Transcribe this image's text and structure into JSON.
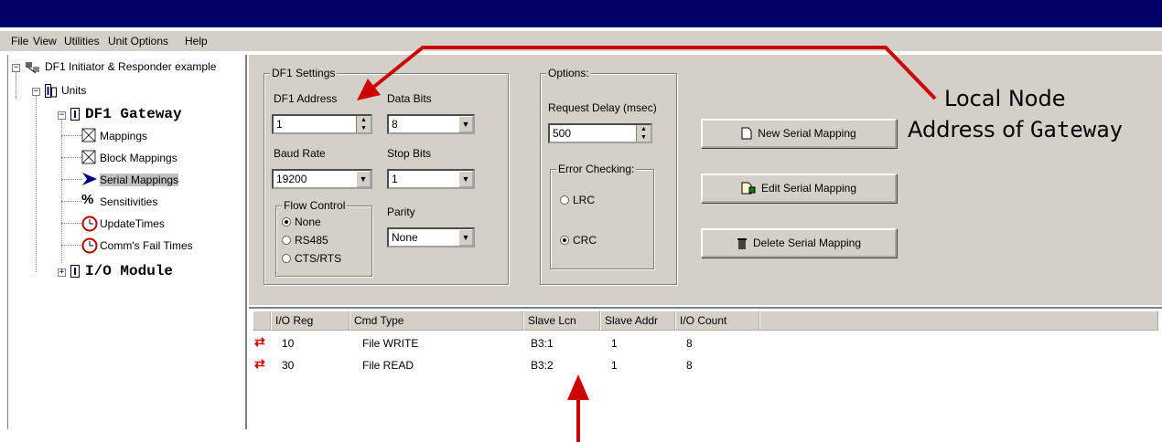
{
  "menu": [
    "File",
    "View",
    "Utilities",
    "Unit Options",
    "Help"
  ],
  "tree": {
    "root": "DF1 Initiator & Responder example",
    "units": "Units",
    "gateway": "DF1 Gateway",
    "mappings": "Mappings",
    "block_mappings": "Block Mappings",
    "serial_mappings": "Serial Mappings",
    "sensitivities": "Sensitivities",
    "update_times": "UpdateTimes",
    "comms_fail_times": "Comm's Fail Times",
    "io_module": "I/O Module"
  },
  "df1_settings": {
    "title": "DF1 Settings",
    "address_label": "DF1 Address",
    "address_value": "1",
    "data_bits_label": "Data Bits",
    "data_bits_value": "8",
    "baud_label": "Baud Rate",
    "baud_value": "19200",
    "stop_bits_label": "Stop Bits",
    "stop_bits_value": "1",
    "flow_title": "Flow Control",
    "flow_options": [
      "None",
      "RS485",
      "CTS/RTS"
    ],
    "flow_selected": "None",
    "parity_label": "Parity",
    "parity_value": "None"
  },
  "options": {
    "title": "Options:",
    "delay_label": "Request Delay (msec)",
    "delay_value": "500",
    "error_title": "Error Checking:",
    "lrc": "LRC",
    "crc": "CRC",
    "selected": "CRC"
  },
  "buttons": {
    "new": "New Serial Mapping",
    "edit": "Edit Serial Mapping",
    "delete": "Delete Serial Mapping"
  },
  "annotation": {
    "line1": "Local Node",
    "line2_a": "Address of ",
    "line2_b": "Gateway"
  },
  "table": {
    "columns": [
      "I/O Reg",
      "Cmd Type",
      "Slave Lcn",
      "Slave Addr",
      "I/O Count"
    ],
    "rows": [
      {
        "reg": "10",
        "cmd": "File WRITE",
        "lcn": "B3:1",
        "addr": "1",
        "count": "8"
      },
      {
        "reg": "30",
        "cmd": "File READ",
        "lcn": "B3:2",
        "addr": "1",
        "count": "8"
      }
    ]
  },
  "colors": {
    "titlebar": "#000066",
    "arrow": "#cc0000",
    "panel": "#d4d0c8"
  }
}
